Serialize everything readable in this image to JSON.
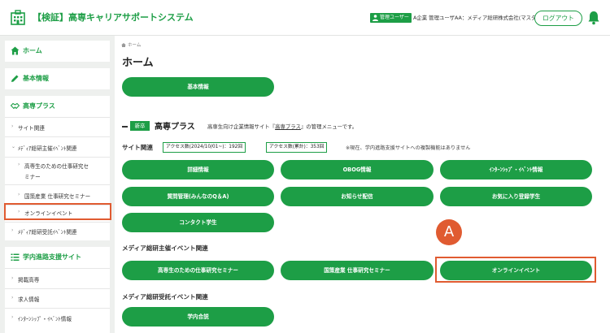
{
  "header": {
    "app_title": "【検証】高専キャリアサポートシステム",
    "role_badge": "管理ユーザー",
    "user_name": "A企業 管理ユーザAA：メディア総研株式会社(マスタ)",
    "logout_label": "ログアウト"
  },
  "sidebar": {
    "home": "ホーム",
    "basic_info": "基本情報",
    "kosen_plus": "高専プラス",
    "kosen_items": [
      "サイト関連",
      "ﾒﾃﾞｨｱ総研主催ｲﾍﾞﾝﾄ関連",
      "高専生のための仕事研究セ",
      "ミナー",
      "国策産業 仕事研究セミナー",
      "オンラインイベント",
      "ﾒﾃﾞｨｱ総研受託ｲﾍﾞﾝﾄ関連"
    ],
    "school_support": "学内進路支援サイト",
    "school_items": [
      "掲載高専",
      "求人情報",
      "ｲﾝﾀｰﾝｼｯﾌﾟ・ｲﾍﾞﾝﾄ情報"
    ]
  },
  "main": {
    "breadcrumb": "ホーム",
    "page_title": "ホーム",
    "basic_info_btn": "基本情報",
    "new_badge": "新卒",
    "section_title": "高専プラス",
    "section_desc_pre": "高専生向け企業情報サイト『",
    "section_desc_link": "高専プラス",
    "section_desc_post": "』の管理メニューです。",
    "site_related": "サイト関連",
    "access_since": "アクセス数(2024/10/01~)：192回",
    "access_total": "アクセス数(累計)：353回",
    "notice": "※現在、学内進路支援サイトへの複製機能はありません",
    "site_buttons": [
      "詳細情報",
      "OBOG情報",
      "ｲﾝﾀｰﾝｼｯﾌﾟ・ｲﾍﾞﾝﾄ情報",
      "質問管理(みんなのQ＆A)",
      "お知らせ配信",
      "お気に入り登録学生",
      "コンタクト学生"
    ],
    "media_hosted": "メディア総研主催イベント関連",
    "hosted_buttons": [
      "高専生のための仕事研究セミナー",
      "国策産業 仕事研究セミナー",
      "オンラインイベント"
    ],
    "media_contracted": "メディア総研受託イベント関連",
    "contracted_buttons": [
      "学内合説"
    ],
    "annotation_label": "A"
  },
  "colors": {
    "accent_green": "#1d9e46",
    "annotation_orange": "#e05b31"
  },
  "icons": [
    "building-icon",
    "person-icon",
    "bell-icon",
    "home-icon",
    "pencil-icon",
    "handshake-icon",
    "list-icon"
  ]
}
